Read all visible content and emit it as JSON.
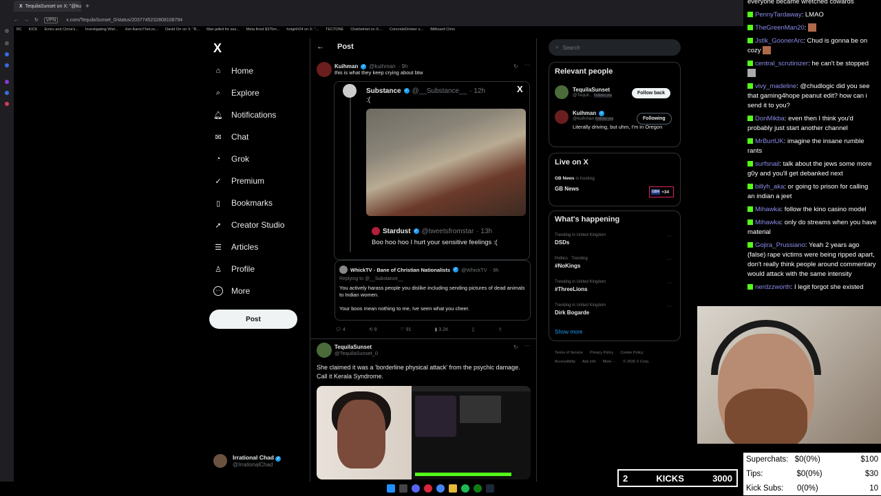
{
  "browser": {
    "tabs": [
      "TequilaSunset on X: \"@ku"
    ],
    "new_tab": "+",
    "url": "x.com/TequilaSunset_0/status/2037745232808108794",
    "vpn_label": "VPN",
    "bookmarks": [
      "BC",
      "KICK",
      "Emiru and Cinna's...",
      "Investigating Wizt...",
      "Xen AaronTheLoc...",
      "David Orr on X: \"R...",
      "Man jailed for ass...",
      "Meta fined $375m...",
      "hotgirl#24 on X: \"...",
      "TECTONE",
      "CharlieIntel on X:...",
      "ConcreteDrinker o...",
      "Billboard Chris"
    ]
  },
  "nav": {
    "logo": "X",
    "items": [
      {
        "label": "Home",
        "icon": "⌂"
      },
      {
        "label": "Explore",
        "icon": "⌕"
      },
      {
        "label": "Notifications",
        "icon": "🔔︎"
      },
      {
        "label": "Chat",
        "icon": "✉"
      },
      {
        "label": "Grok",
        "icon": "◔"
      },
      {
        "label": "Premium",
        "icon": "✓"
      },
      {
        "label": "Bookmarks",
        "icon": "▯"
      },
      {
        "label": "Creator Studio",
        "icon": "➚"
      },
      {
        "label": "Articles",
        "icon": "☰"
      },
      {
        "label": "Profile",
        "icon": "♙"
      },
      {
        "label": "More",
        "icon": "⋯"
      }
    ],
    "post_button": "Post",
    "account": {
      "name": "Irrational Chad",
      "handle": "@IrrationalChad"
    }
  },
  "main": {
    "header": "Post",
    "tweet1": {
      "name": "Kuihman",
      "handle": "@kuihman",
      "time": "· 9h",
      "text": "this is what they keep crying about btw"
    },
    "quoted": {
      "name": "Substance",
      "handle": "@__Substance__",
      "time": "· 12h",
      "text": ":(",
      "sub_name": "Stardust",
      "sub_handle": "@tweetsfromstar",
      "sub_time": "· 13h",
      "sub_text": "Boo hoo hoo I hurt your sensitive feelings :("
    },
    "reply": {
      "name": "WhickTV - Bane of Christian Nationalists",
      "handle": "@WhickTV",
      "time": "· 9h",
      "replying": "Replying to @__Substance__",
      "text1": "You actively harass people you dislike including sending pictures of dead animals to Indian women.",
      "text2": "Your boos mean nothing to me, Ive seen what you cheer."
    },
    "actions": {
      "replies": "4",
      "reposts": "9",
      "likes": "91",
      "views": "3.2K"
    },
    "tweet2": {
      "name": "TequilaSunset",
      "handle": "@TequilaSunset_0",
      "text": "She claimed it was a 'borderline physical attack' from the psychic damage. Call it Kerala Syndrome."
    }
  },
  "right": {
    "search_placeholder": "Search",
    "relevant_title": "Relevant people",
    "people": [
      {
        "name": "TequilaSunset",
        "handle": "@Tequil...",
        "follows": "Follows you",
        "button": "Follow back"
      },
      {
        "name": "Kuihman",
        "handle": "@kuihman",
        "follows": "Follows you",
        "button": "Following",
        "bio": "Literally driving, but uhm, I'm in Oregon"
      }
    ],
    "live_title": "Live on X",
    "live": {
      "host": "GB News",
      "hosting": "is hosting",
      "title": "GB News",
      "count": "+34",
      "logo_text": "GBN"
    },
    "happening_title": "What's happening",
    "trends": [
      {
        "context": "Trending in United Kingdom",
        "name": "DSDs"
      },
      {
        "context": "Politics · Trending",
        "name": "#NoKings"
      },
      {
        "context": "Trending in United Kingdom",
        "name": "#ThreeLions"
      },
      {
        "context": "Trending in United Kingdom",
        "name": "Dirk Bogarde"
      }
    ],
    "show_more": "Show more",
    "footer1": [
      "Terms of Service",
      "Privacy Policy",
      "Cookie Policy"
    ],
    "footer2": [
      "Accessibility",
      "Ads info",
      "More ···",
      "© 2026 X Corp."
    ]
  },
  "chat": {
    "top_text": "everyone became wretched cowards",
    "messages": [
      {
        "user": "PennyTardaway",
        "text": "LMAO"
      },
      {
        "user": "TheGreenMan20",
        "text": ""
      },
      {
        "user": "Jstlk_GoonerArc",
        "text": "Chud is gonna be on cozy"
      },
      {
        "user": "central_scrutinizer",
        "text": "he can't be stopped"
      },
      {
        "user": "vivy_madeline",
        "text": "@chudlogic did you see that gaming4hope peanut edit? how can i send it to you?"
      },
      {
        "user": "DonMikba",
        "text": "even then I think you'd probably just start another channel"
      },
      {
        "user": "MrBurtUK",
        "text": "imagine the insane rumble rants"
      },
      {
        "user": "surfsnail",
        "text": "talk about the jews some more g0y and you'll get debanked next"
      },
      {
        "user": "billyh_aka",
        "text": "or going to prison for calling an indian a jeet"
      },
      {
        "user": "Mihawka",
        "text": "follow the kino casino model"
      },
      {
        "user": "Mihawka",
        "text": "only do streams when you have material"
      },
      {
        "user": "Gojira_Prussiano",
        "text": "Yeah 2 years ago (false) rape victims were being ripped apart, don't really think people around commentary would attack with the same intensity"
      },
      {
        "user": "nerdzzworth",
        "text": "I legit forgot she existed"
      }
    ]
  },
  "kicks_bar": {
    "count": "2",
    "label": "KICKS",
    "goal": "3000"
  },
  "stats": [
    {
      "label": "Superchats:",
      "value": "$0(0%)",
      "goal": "$100"
    },
    {
      "label": "Tips:",
      "value": "$0(0%)",
      "goal": "$30"
    },
    {
      "label": "Kick Subs:",
      "value": "0(0%)",
      "goal": "10"
    }
  ],
  "colors": {
    "accent": "#1d9bf0",
    "kick_green": "#53fc18",
    "chat_name": "#8a8ce8"
  }
}
